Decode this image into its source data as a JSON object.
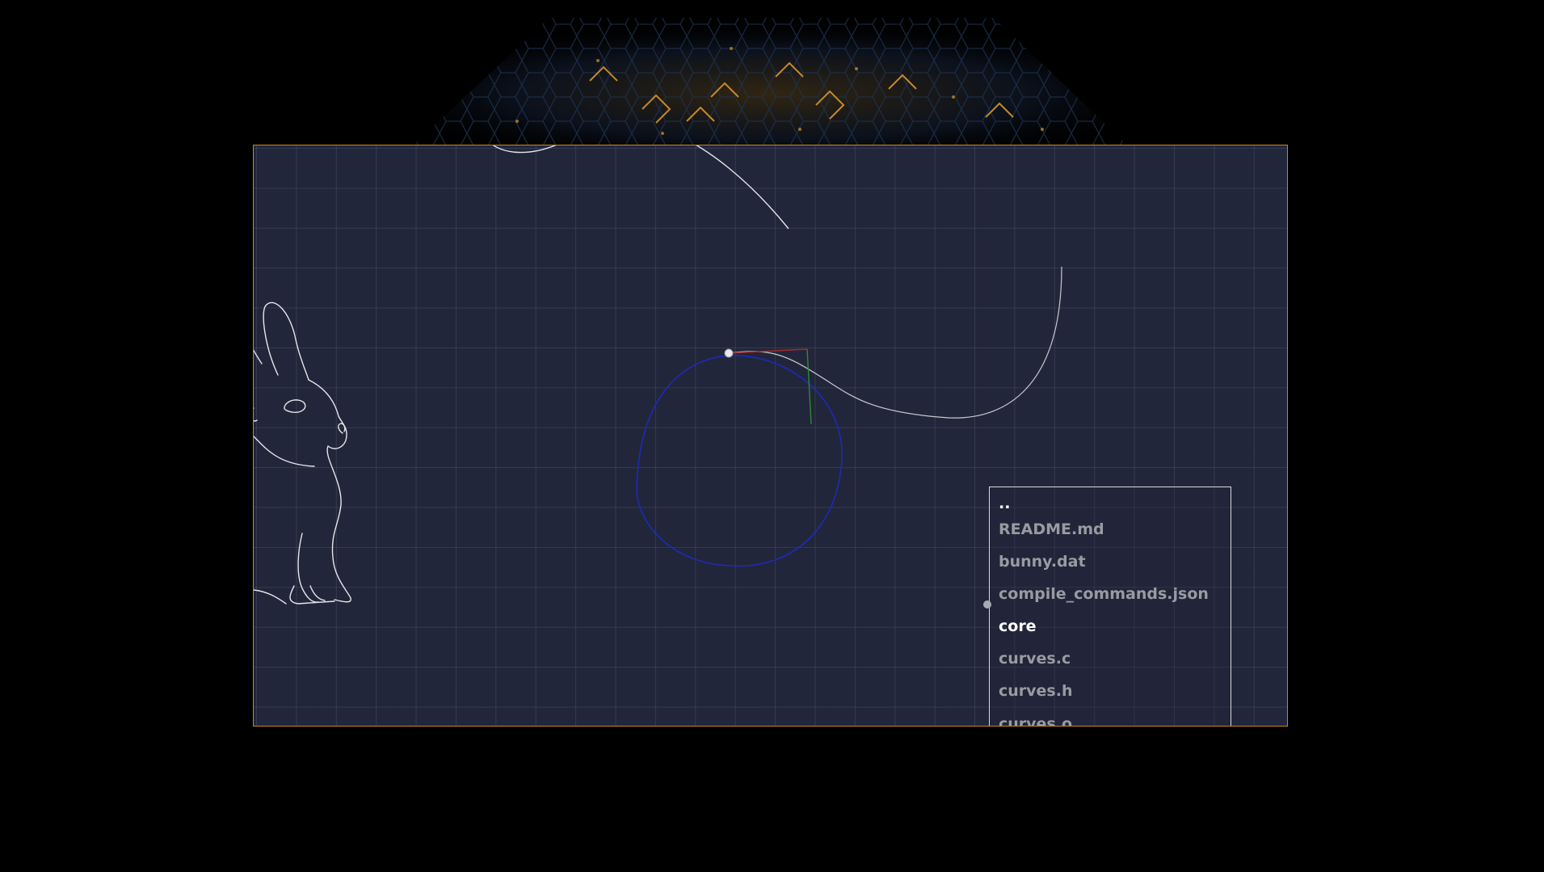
{
  "theme": {
    "background": "#000000",
    "viewport_fill": "#22263a",
    "viewport_border": "#c8861f",
    "grid_line": "#4a5068",
    "curve_color": "#e6e6ea",
    "circle_color": "#1e2ab8",
    "directory_text": "#ffffff",
    "file_text": "#9a9aa2",
    "backdrop_accent": "#d9962a"
  },
  "file_browser": {
    "entries": [
      {
        "label": "..",
        "kind": "directory"
      },
      {
        "label": "README.md",
        "kind": "file"
      },
      {
        "label": "bunny.dat",
        "kind": "file"
      },
      {
        "label": "compile_commands.json",
        "kind": "file"
      },
      {
        "label": "core",
        "kind": "directory"
      },
      {
        "label": "curves.c",
        "kind": "file"
      },
      {
        "label": "curves.h",
        "kind": "file"
      },
      {
        "label": "curves.o",
        "kind": "file"
      }
    ]
  },
  "canvas": {
    "drawings": [
      "bunny-outline",
      "bezier-curve",
      "unit-circle",
      "tangent-handles"
    ],
    "icons": [
      "control-point-icon",
      "cursor-dot-icon"
    ]
  }
}
